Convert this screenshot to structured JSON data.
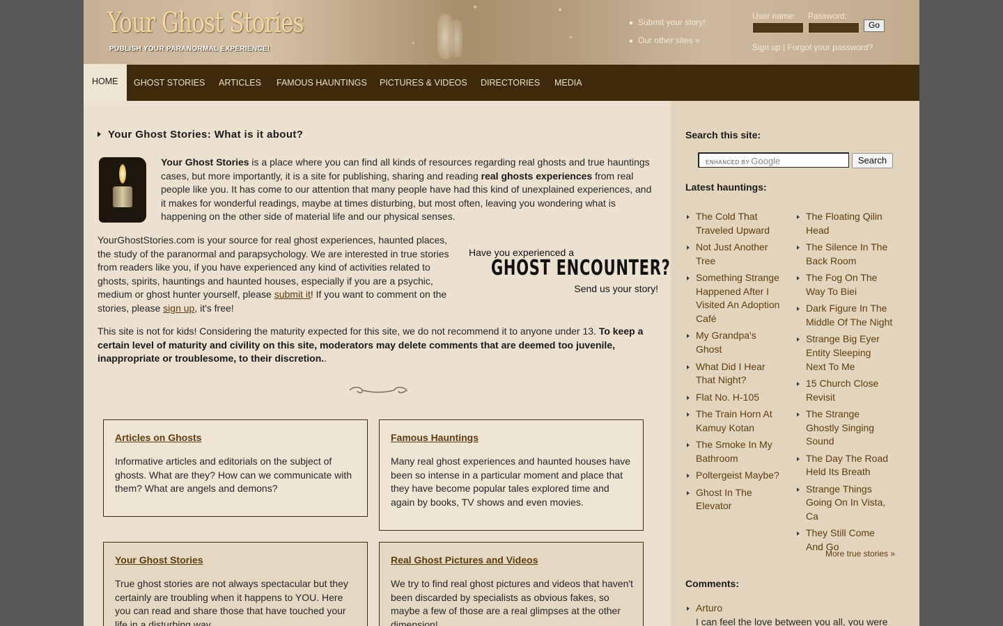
{
  "header": {
    "logo_title": "Your Ghost Stories",
    "logo_subtitle": "PUBLISH YOUR PARANORMAL EXPERIENCE!",
    "links": [
      "Submit your story!",
      "Our other sites »"
    ],
    "login": {
      "username_label": "User name:",
      "password_label": "Password:",
      "go_label": "Go",
      "signup_label": "Sign up",
      "separator": " | ",
      "forgot_label": "Forgot your password?"
    }
  },
  "nav": {
    "items": [
      "HOME",
      "GHOST STORIES",
      "ARTICLES",
      "FAMOUS HAUNTINGS",
      "PICTURES & VIDEOS",
      "DIRECTORIES",
      "MEDIA"
    ],
    "active": "HOME"
  },
  "main": {
    "heading": "Your Ghost Stories: What is it about?",
    "intro": {
      "b1": "Your Ghost Stories",
      "t1": " is a place where you can find all kinds of resources regarding real ghosts and true hauntings cases, but more importantly, it is a site for publishing, sharing and reading ",
      "b2": "real ghosts experiences",
      "t2": " from real people like you. It has come to our attention that many people have had this kind of unexplained experiences, and it makes for wonderful readings, maybe at times disturbing, but most often, leaving you wondering what is happening on the other side of material life and our physical senses."
    },
    "p2": {
      "t1": "YourGhostStories.com is your source for real ghost experiences, haunted places, the study of the paranormal and parapsychology. We are interested in true stories from readers like you, if you have experienced any kind of activities related to ghosts, spirits, hauntings and haunted houses, especially if you are a psychic, medium or ghost hunter yourself, please ",
      "link1": "submit it",
      "t2": "! If you want to comment on the stories, please ",
      "link2": "sign up",
      "t3": ", it's free!"
    },
    "p3": {
      "t1": "This site is not for kids! Considering the maturity expected for this site, we do not recommend it to anyone under 13. ",
      "b1": "To keep a certain level of maturity and civility on this site, moderators may delete comments that are deemed too juvenile, inappropriate or troublesome, to their discretion.",
      "t2": "."
    },
    "ad": {
      "line1": "Have you experienced a",
      "line2": "GHOST ENCOUNTER?",
      "line3": "Send us your story!"
    },
    "boxes": [
      {
        "title": "Articles on Ghosts",
        "body": "Informative articles and editorials on the subject of ghosts. What are they? How can we communicate with them? What are angels and demons?"
      },
      {
        "title": "Famous Hauntings",
        "body": "Many real ghost experiences and haunted houses have been so intense in a particular moment and place that they have become popular tales explored time and again by books, TV shows and even movies."
      },
      {
        "title": "Your Ghost Stories",
        "body": "True ghost stories are not always spectacular but they certainly are troubling when it happens to YOU. Here you can read and share those that have touched your life in a disturbing way."
      },
      {
        "title": "Real Ghost Pictures and Videos",
        "body": "We try to find real ghost pictures and videos that haven't been discarded by specialists as obvious fakes, so maybe a few of those are a real glimpses at the other dimension!"
      }
    ]
  },
  "sidebar": {
    "search_heading": "Search this site:",
    "search_enhanced": "ENHANCED BY",
    "search_brand": "Google",
    "search_button": "Search",
    "hauntings_heading": "Latest hauntings:",
    "hauntings_col1": [
      "The Cold That Traveled Upward",
      "Not Just Another Tree",
      "Something Strange Happened After I Visited An Adoption Café",
      "My Grandpa's Ghost",
      "What Did I Hear That Night?",
      "Flat No. H-105",
      "The Train Horn At Kamuy Kotan",
      "The Smoke In My Bathroom",
      "Poltergeist Maybe?",
      "Ghost In The Elevator"
    ],
    "hauntings_col2": [
      "The Floating Qilin Head",
      "The Silence In The Back Room",
      "The Fog On The Way To Biei",
      "Dark Figure In The Middle Of The Night",
      "Strange Big Eyer Entity Sleeping Next To Me",
      "15 Church Close Revisit",
      "The Strange Ghostly Singing Sound",
      "The Day The Road Held Its Breath",
      "Strange Things Going On In Vista, Ca",
      "They Still Come And Go"
    ],
    "more_label": "More true stories »",
    "comments_heading": "Comments:",
    "comment_author": "Arturo",
    "comment_text": "I can feel the love between you all, you were"
  }
}
